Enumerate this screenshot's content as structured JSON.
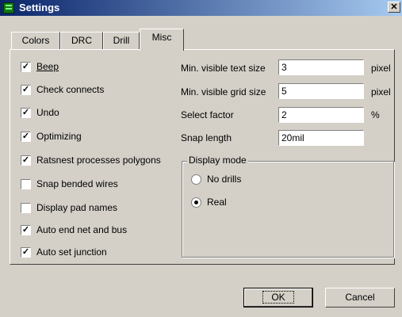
{
  "window": {
    "title": "Settings",
    "close_glyph": "✕"
  },
  "tabs": [
    {
      "label": "Colors"
    },
    {
      "label": "DRC"
    },
    {
      "label": "Drill"
    },
    {
      "label": "Misc",
      "active": true
    }
  ],
  "checkboxes": [
    {
      "label": "Beep",
      "checked": true
    },
    {
      "label": "Check connects",
      "checked": true
    },
    {
      "label": "Undo",
      "checked": true
    },
    {
      "label": "Optimizing",
      "checked": true
    },
    {
      "label": "Ratsnest processes polygons",
      "checked": true
    },
    {
      "label": "Snap bended wires",
      "checked": false
    },
    {
      "label": "Display pad names",
      "checked": false
    },
    {
      "label": "Auto end net and bus",
      "checked": true
    },
    {
      "label": "Auto set junction",
      "checked": true
    }
  ],
  "fields": [
    {
      "label": "Min. visible text size",
      "value": "3",
      "unit": "pixel"
    },
    {
      "label": "Min. visible grid size",
      "value": "5",
      "unit": "pixel"
    },
    {
      "label": "Select factor",
      "value": "2",
      "unit": "%"
    },
    {
      "label": "Snap length",
      "value": "20mil",
      "unit": ""
    }
  ],
  "display_mode": {
    "title": "Display mode",
    "options": [
      {
        "label": "No drills",
        "selected": false
      },
      {
        "label": "Real",
        "selected": true
      }
    ]
  },
  "buttons": {
    "ok": "OK",
    "cancel": "Cancel"
  },
  "check_glyph": "✓"
}
